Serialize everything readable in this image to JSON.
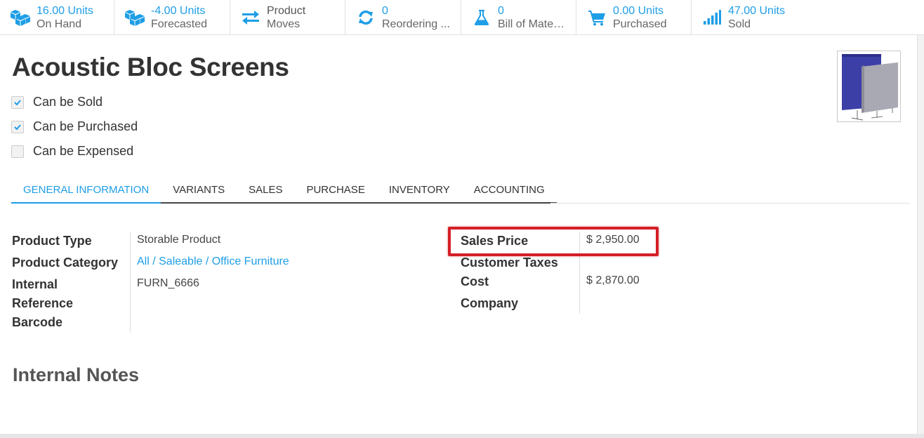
{
  "smart_buttons": [
    {
      "value": "16.00 Units",
      "label": "On Hand",
      "icon": "cubes-icon"
    },
    {
      "value": "-4.00 Units",
      "label": "Forecasted",
      "icon": "cubes-icon"
    },
    {
      "value": "Product",
      "label": "Moves",
      "icon": "exchange-icon"
    },
    {
      "value": "0",
      "label": "Reordering ...",
      "icon": "refresh-icon"
    },
    {
      "value": "0",
      "label": "Bill of Materi...",
      "icon": "flask-icon"
    },
    {
      "value": "0.00 Units",
      "label": "Purchased",
      "icon": "cart-icon"
    },
    {
      "value": "47.00 Units",
      "label": "Sold",
      "icon": "signal-icon"
    }
  ],
  "product": {
    "name": "Acoustic Bloc Screens",
    "can_be_sold": {
      "label": "Can be Sold",
      "checked": true
    },
    "can_be_purchased": {
      "label": "Can be Purchased",
      "checked": true
    },
    "can_be_expensed": {
      "label": "Can be Expensed",
      "checked": false
    }
  },
  "tabs": [
    "GENERAL INFORMATION",
    "VARIANTS",
    "SALES",
    "PURCHASE",
    "INVENTORY",
    "ACCOUNTING"
  ],
  "active_tab": "GENERAL INFORMATION",
  "fields_left": {
    "product_type_label": "Product Type",
    "product_type_value": "Storable Product",
    "category_label": "Product Category",
    "category_value": "All / Saleable / Office Furniture",
    "internal_ref_label_1": "Internal",
    "internal_ref_label_2": "Reference",
    "internal_ref_value": "FURN_6666",
    "barcode_label": "Barcode"
  },
  "fields_right": {
    "sales_price_label": "Sales Price",
    "sales_price_value": "$ 2,950.00",
    "customer_taxes_label": "Customer Taxes",
    "cost_label": "Cost",
    "cost_value": "$ 2,870.00",
    "company_label": "Company"
  },
  "notes": {
    "title": "Internal Notes"
  },
  "colors": {
    "accent": "#1e9ee6",
    "highlight": "#d41f26"
  }
}
